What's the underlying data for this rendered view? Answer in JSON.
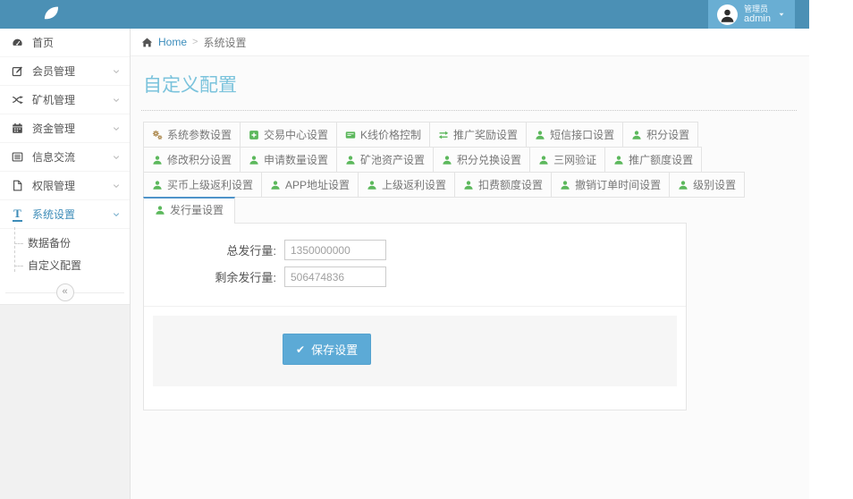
{
  "topbar": {
    "brand_icon": "leaf-icon",
    "user": {
      "role": "管理员",
      "name": "admin"
    }
  },
  "sidebar": {
    "items": [
      {
        "label": "首页",
        "icon": "dashboard-icon",
        "has_submenu": false,
        "active": false
      },
      {
        "label": "会员管理",
        "icon": "pencil-icon",
        "has_submenu": true,
        "active": false
      },
      {
        "label": "矿机管理",
        "icon": "shuffle-icon",
        "has_submenu": true,
        "active": false
      },
      {
        "label": "资金管理",
        "icon": "calendar-icon",
        "has_submenu": true,
        "active": false
      },
      {
        "label": "信息交流",
        "icon": "list-icon",
        "has_submenu": true,
        "active": false
      },
      {
        "label": "权限管理",
        "icon": "file-icon",
        "has_submenu": true,
        "active": false
      },
      {
        "label": "系统设置",
        "icon": "text-icon",
        "has_submenu": true,
        "active": true
      }
    ],
    "subitems": [
      {
        "label": "数据备份",
        "active": false
      },
      {
        "label": "自定义配置",
        "active": true
      }
    ],
    "collapse_glyph": "«"
  },
  "breadcrumb": {
    "home_icon": "home-icon",
    "home": "Home",
    "separator": ">",
    "current": "系统设置"
  },
  "page": {
    "title": "自定义配置"
  },
  "tabs": {
    "rows": [
      [
        {
          "label": "系统参数设置",
          "icon": "cogs-icon",
          "icon_color": "#ad8a50"
        },
        {
          "label": "交易中心设置",
          "icon": "plus-square-icon",
          "icon_color": "#5cb85c"
        },
        {
          "label": "K线价格控制",
          "icon": "card-icon",
          "icon_color": "#5cb85c"
        },
        {
          "label": "推广奖励设置",
          "icon": "exchange-icon",
          "icon_color": "#5cb85c"
        },
        {
          "label": "短信接口设置",
          "icon": "user-icon",
          "icon_color": "#5cb85c"
        },
        {
          "label": "积分设置",
          "icon": "user-icon",
          "icon_color": "#5cb85c"
        }
      ],
      [
        {
          "label": "修改积分设置",
          "icon": "user-icon",
          "icon_color": "#5cb85c"
        },
        {
          "label": "申请数量设置",
          "icon": "user-icon",
          "icon_color": "#5cb85c"
        },
        {
          "label": "矿池资产设置",
          "icon": "user-icon",
          "icon_color": "#5cb85c"
        },
        {
          "label": "积分兑换设置",
          "icon": "user-icon",
          "icon_color": "#5cb85c"
        },
        {
          "label": "三网验证",
          "icon": "user-icon",
          "icon_color": "#5cb85c"
        },
        {
          "label": "推广额度设置",
          "icon": "user-icon",
          "icon_color": "#5cb85c"
        }
      ],
      [
        {
          "label": "买币上级返利设置",
          "icon": "user-icon",
          "icon_color": "#5cb85c"
        },
        {
          "label": "APP地址设置",
          "icon": "user-icon",
          "icon_color": "#5cb85c"
        },
        {
          "label": "上级返利设置",
          "icon": "user-icon",
          "icon_color": "#5cb85c"
        },
        {
          "label": "扣费额度设置",
          "icon": "user-icon",
          "icon_color": "#5cb85c"
        },
        {
          "label": "撤销订单时间设置",
          "icon": "user-icon",
          "icon_color": "#5cb85c"
        },
        {
          "label": "级别设置",
          "icon": "user-icon",
          "icon_color": "#5cb85c"
        }
      ]
    ],
    "active": {
      "label": "发行量设置",
      "icon": "user-icon",
      "icon_color": "#5cb85c"
    }
  },
  "form": {
    "fields": [
      {
        "label": "总发行量:",
        "value": "1350000000"
      },
      {
        "label": "剩余发行量:",
        "value": "506474836"
      }
    ],
    "save_icon": "check-icon",
    "save_label": "保存设置"
  },
  "colors": {
    "topbar": "#4b90b5",
    "topbar_user_bg": "#69aed3",
    "accent_blue": "#3c8dbc",
    "tab_active_border": "#4e93c9",
    "green": "#5cb85c",
    "title": "#7bc3dc",
    "button": "#5caad6"
  }
}
